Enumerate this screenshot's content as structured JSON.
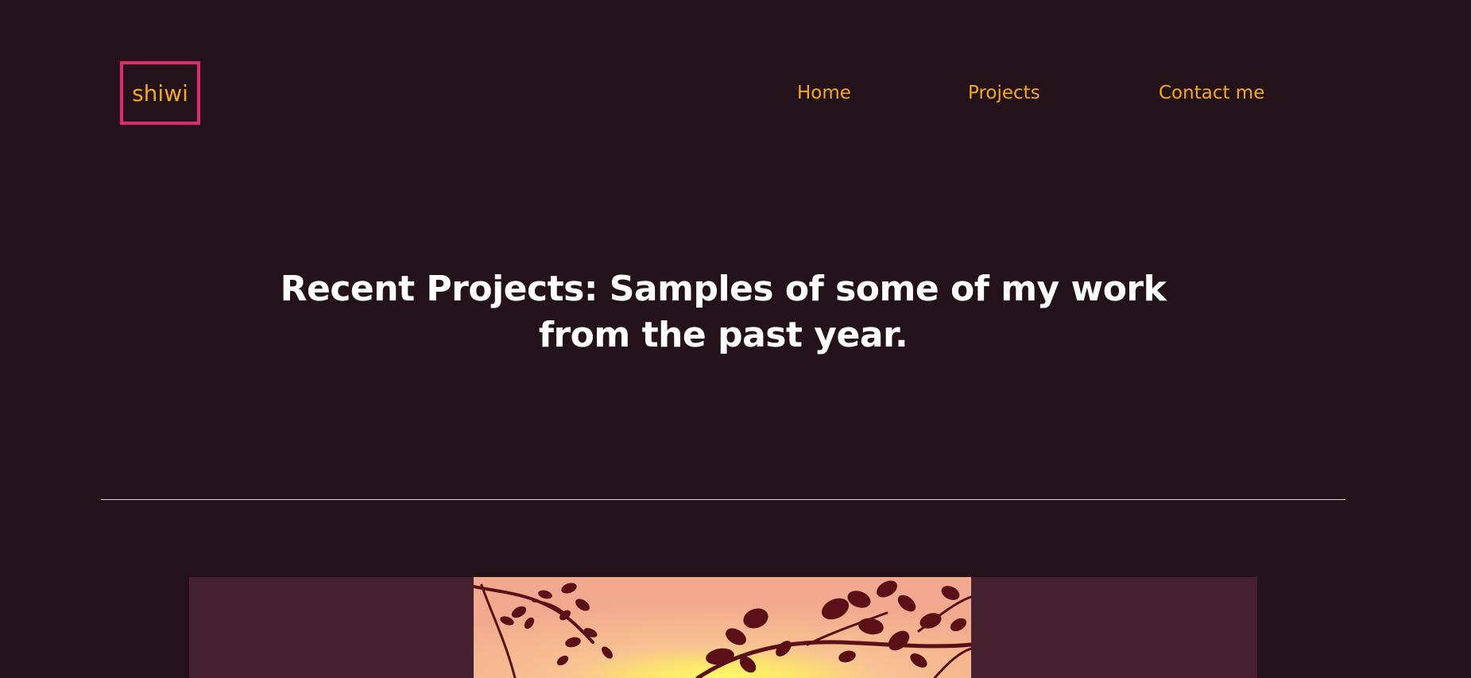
{
  "header": {
    "logo_text": "shiwi",
    "nav": [
      {
        "label": "Home"
      },
      {
        "label": "Projects"
      },
      {
        "label": "Contact me"
      }
    ]
  },
  "hero": {
    "title": "Recent Projects: Samples of some of my work from the past year."
  },
  "colors": {
    "background": "#231219",
    "accent": "#f4a81c",
    "logo_border": "#e4286f",
    "card_background": "#45212f",
    "heading": "#ffffff"
  },
  "projects": [
    {
      "image_icon": "sunset-branches-illustration"
    }
  ]
}
